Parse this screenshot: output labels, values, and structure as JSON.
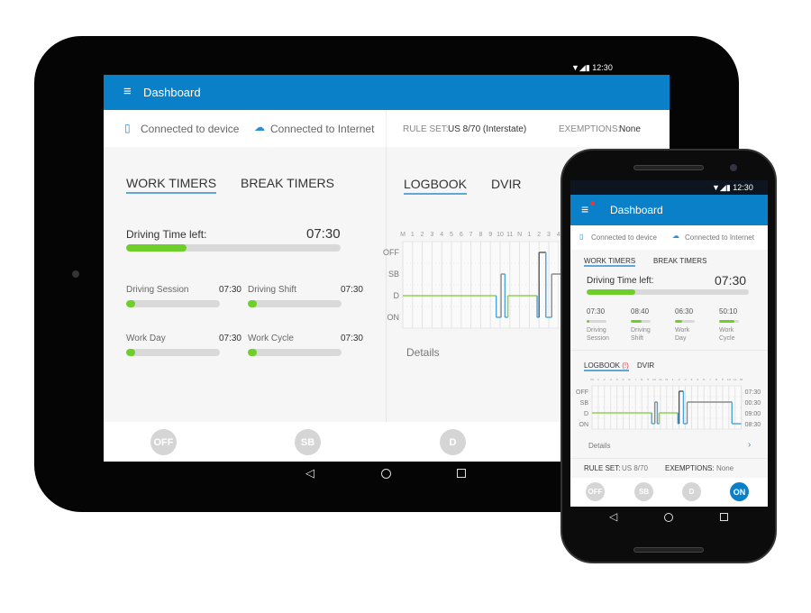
{
  "tablet": {
    "status_time": "12:30",
    "header_title": "Dashboard",
    "connected_device": "Connected to device",
    "connected_internet": "Connected to Internet",
    "rule_set_label": "RULE SET:",
    "rule_set_value": "US 8/70 (Interstate)",
    "exemptions_label": "EXEMPTIONS:",
    "exemptions_value": "None",
    "tabs_left": [
      "WORK TIMERS",
      "BREAK TIMERS"
    ],
    "tabs_right": [
      "LOGBOOK",
      "DVIR"
    ],
    "driving_time_label": "Driving Time left:",
    "driving_time_value": "07:30",
    "driving_time_progress": 0.28,
    "timers": [
      {
        "label": "Driving Session",
        "value": "07:30",
        "progress": 0.1
      },
      {
        "label": "Driving Shift",
        "value": "07:30",
        "progress": 0.1
      },
      {
        "label": "Work Day",
        "value": "07:30",
        "progress": 0.1
      },
      {
        "label": "Work Cycle",
        "value": "07:30",
        "progress": 0.1
      }
    ],
    "details_label": "Details",
    "status_buttons": [
      "OFF",
      "SB",
      "D"
    ]
  },
  "phone": {
    "status_time": "12:30",
    "header_title": "Dashboard",
    "connected_device": "Connected to device",
    "connected_internet": "Connected to Internet",
    "tabs_top": [
      "WORK TIMERS",
      "BREAK TIMERS"
    ],
    "driving_time_label": "Driving Time left:",
    "driving_time_value": "07:30",
    "driving_time_progress": 0.3,
    "timers": [
      {
        "value": "07:30",
        "label": "Driving Session",
        "progress": 0.15
      },
      {
        "value": "08:40",
        "label": "Driving Shift",
        "progress": 0.55
      },
      {
        "value": "06:30",
        "label": "Work Day",
        "progress": 0.35
      },
      {
        "value": "50:10",
        "label": "Work Cycle",
        "progress": 0.75
      }
    ],
    "logbook_label": "LOGBOOK",
    "logbook_alert": "(!)",
    "dvir_label": "DVIR",
    "details_label": "Details",
    "rule_set_label": "RULE SET:",
    "rule_set_value": "US 8/70",
    "exemptions_label": "EXEMPTIONS:",
    "exemptions_value": "None",
    "status_buttons": [
      "OFF",
      "SB",
      "D",
      "ON"
    ],
    "active_status": "ON"
  },
  "chart_data": {
    "type": "line",
    "hour_labels": [
      "M",
      "1",
      "2",
      "3",
      "4",
      "5",
      "6",
      "7",
      "8",
      "9",
      "10",
      "11",
      "N",
      "1",
      "2",
      "3",
      "4",
      "5",
      "6",
      "7",
      "8",
      "9",
      "10",
      "11",
      "M"
    ],
    "rows": [
      "OFF",
      "SB",
      "D",
      "ON"
    ],
    "totals": {
      "OFF": "07:30",
      "SB": "00:30",
      "D": "09:00",
      "ON": "08:30"
    },
    "segments": [
      {
        "status": "D",
        "start": 0,
        "end": 9.6
      },
      {
        "status": "ON",
        "start": 9.6,
        "end": 10.1
      },
      {
        "status": "SB",
        "start": 10.1,
        "end": 10.5
      },
      {
        "status": "ON",
        "start": 10.5,
        "end": 10.8
      },
      {
        "status": "D",
        "start": 10.8,
        "end": 13.8
      },
      {
        "status": "ON",
        "start": 13.8,
        "end": 14.0
      },
      {
        "status": "OFF",
        "start": 14.0,
        "end": 14.7
      },
      {
        "status": "ON",
        "start": 14.7,
        "end": 15.3
      },
      {
        "status": "SB",
        "start": 15.3,
        "end": 22.5
      },
      {
        "status": "ON",
        "start": 22.5,
        "end": 24
      }
    ],
    "colors": {
      "D": "#8fd14f",
      "ON": "#4aa3d8",
      "SB": "#8a8a8a",
      "OFF": "#555555"
    }
  },
  "colors": {
    "brand": "#0a80c9",
    "progress": "#6fcf2a",
    "alert": "#e53935"
  }
}
